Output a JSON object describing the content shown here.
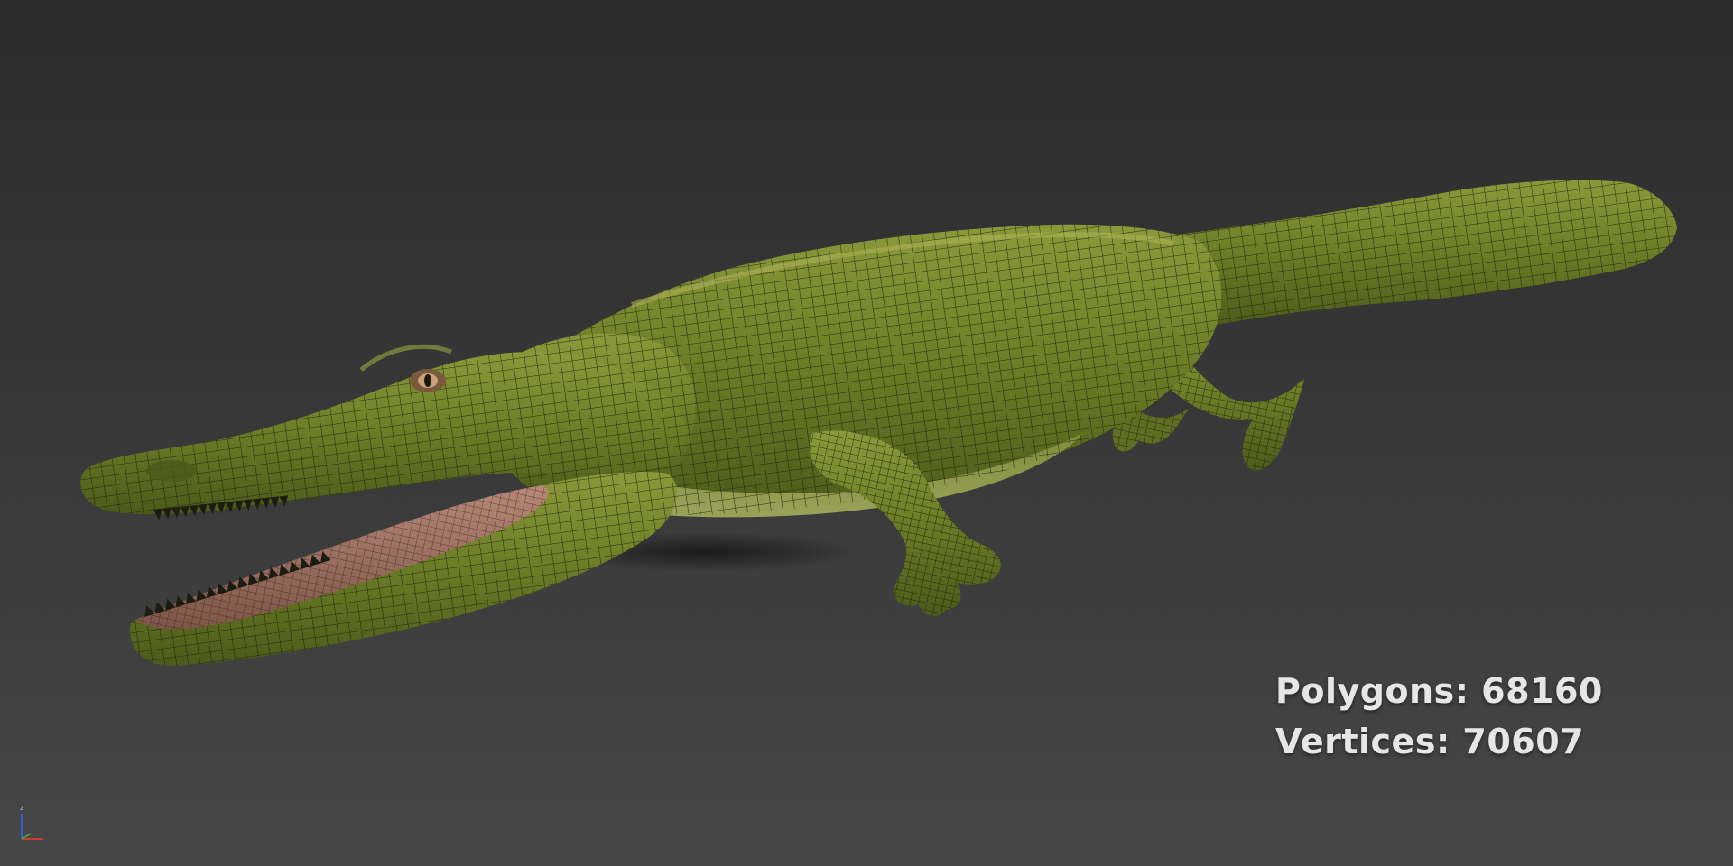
{
  "viewport": {
    "background_top": "#2c2c2c",
    "background_bottom": "#474747"
  },
  "model": {
    "subject": "crocodile",
    "skin_color": "#6f7f2a",
    "wire_color": "#1a1f0c",
    "mouth_color": "#a5705e"
  },
  "stats": {
    "polygons_label": "Polygons:",
    "polygons_value": "68160",
    "vertices_label": "Vertices:",
    "vertices_value": "70607"
  },
  "axis_gizmo": {
    "z_label": "z",
    "x_color": "#d03a2a",
    "y_color": "#3aa03a",
    "z_color": "#3a5ad0"
  }
}
